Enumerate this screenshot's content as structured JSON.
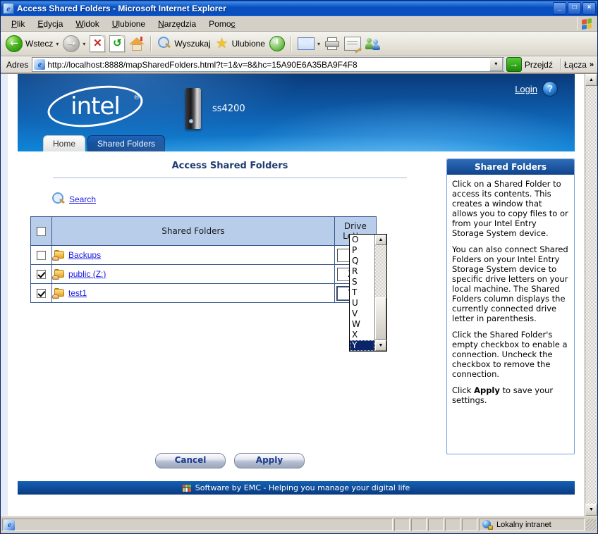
{
  "window": {
    "title": "Access Shared Folders - Microsoft Internet Explorer",
    "icon": "ie-document-icon",
    "minimize_label": "_",
    "maximize_label": "□",
    "close_label": "×"
  },
  "menu": {
    "items": [
      {
        "label": "Plik",
        "accel": "P"
      },
      {
        "label": "Edycja",
        "accel": "E"
      },
      {
        "label": "Widok",
        "accel": "W"
      },
      {
        "label": "Ulubione",
        "accel": "U"
      },
      {
        "label": "Narzędzia",
        "accel": "N"
      },
      {
        "label": "Pomoc",
        "accel": "c"
      }
    ]
  },
  "toolbar": {
    "back_label": "Wstecz",
    "forward_label": "",
    "stop_title": "Zatrzymaj",
    "refresh_title": "Odśwież",
    "home_title": "Strona główna",
    "search_label": "Wyszukaj",
    "favorites_label": "Ulubione",
    "history_title": "Historia",
    "mail_title": "Poczta",
    "print_title": "Drukuj",
    "edit_title": "Edytuj",
    "messenger_title": "Messenger",
    "dropdown_caret": "▾"
  },
  "address": {
    "label": "Adres",
    "url": "http://localhost:8888/mapSharedFolders.html?t=1&v=8&hc=15A90E6A35BA9F4F8",
    "dropdown_caret": "▾",
    "go_label": "Przejdź",
    "go_arrow": "→",
    "links_label": "Łącza",
    "links_chevron": "»"
  },
  "banner": {
    "brand": "intel",
    "registered_mark": "®",
    "device_name": "ss4200",
    "login_label": "Login",
    "help_label": "?"
  },
  "tabs": [
    {
      "label": "Home",
      "active": false
    },
    {
      "label": "Shared Folders",
      "active": true
    }
  ],
  "main": {
    "page_title": "Access Shared Folders",
    "search_label": "Search"
  },
  "table": {
    "headers": {
      "select_all": "",
      "name": "Shared Folders",
      "drive_line1": "Drive",
      "drive_line2": "Letter"
    },
    "select_all_checked": false,
    "rows": [
      {
        "checked": false,
        "name": "Backups",
        "drive": "",
        "drive_disabled": true
      },
      {
        "checked": true,
        "name": "public (Z:)",
        "drive": "Z",
        "drive_disabled": false
      },
      {
        "checked": true,
        "name": "test1",
        "drive": "Y",
        "drive_disabled": false
      }
    ]
  },
  "dropdown": {
    "open": true,
    "options": [
      "O",
      "P",
      "Q",
      "R",
      "S",
      "T",
      "U",
      "V",
      "W",
      "X",
      "Y"
    ],
    "selected": "Y",
    "up_arrow": "▲",
    "down_arrow": "▼"
  },
  "buttons": {
    "cancel": "Cancel",
    "apply": "Apply"
  },
  "help_panel": {
    "title": "Shared Folders",
    "paragraphs": [
      "Click on a Shared Folder to access its contents. This creates a window that allows you to copy files to or from your Intel Entry Storage System device.",
      "You can also connect Shared Folders on your Intel Entry Storage System device to specific drive letters on your local machine. The Shared Folders column displays the currently connected drive letter in parenthesis.",
      "Click the Shared Folder's empty checkbox to enable a connection. Uncheck the checkbox to remove the connection."
    ],
    "final_prefix": "Click ",
    "final_bold": "Apply",
    "final_suffix": " to save your settings."
  },
  "footer": {
    "text": "Software by EMC - Helping you manage your digital life"
  },
  "statusbar": {
    "message": "",
    "zone": "Lokalny intranet"
  },
  "colors": {
    "accent_blue": "#0d5aa8",
    "link_blue": "#1a1ae0",
    "table_header": "#b7cdea",
    "titlebar": "#0a4fc0",
    "selection": "#0a246a"
  }
}
